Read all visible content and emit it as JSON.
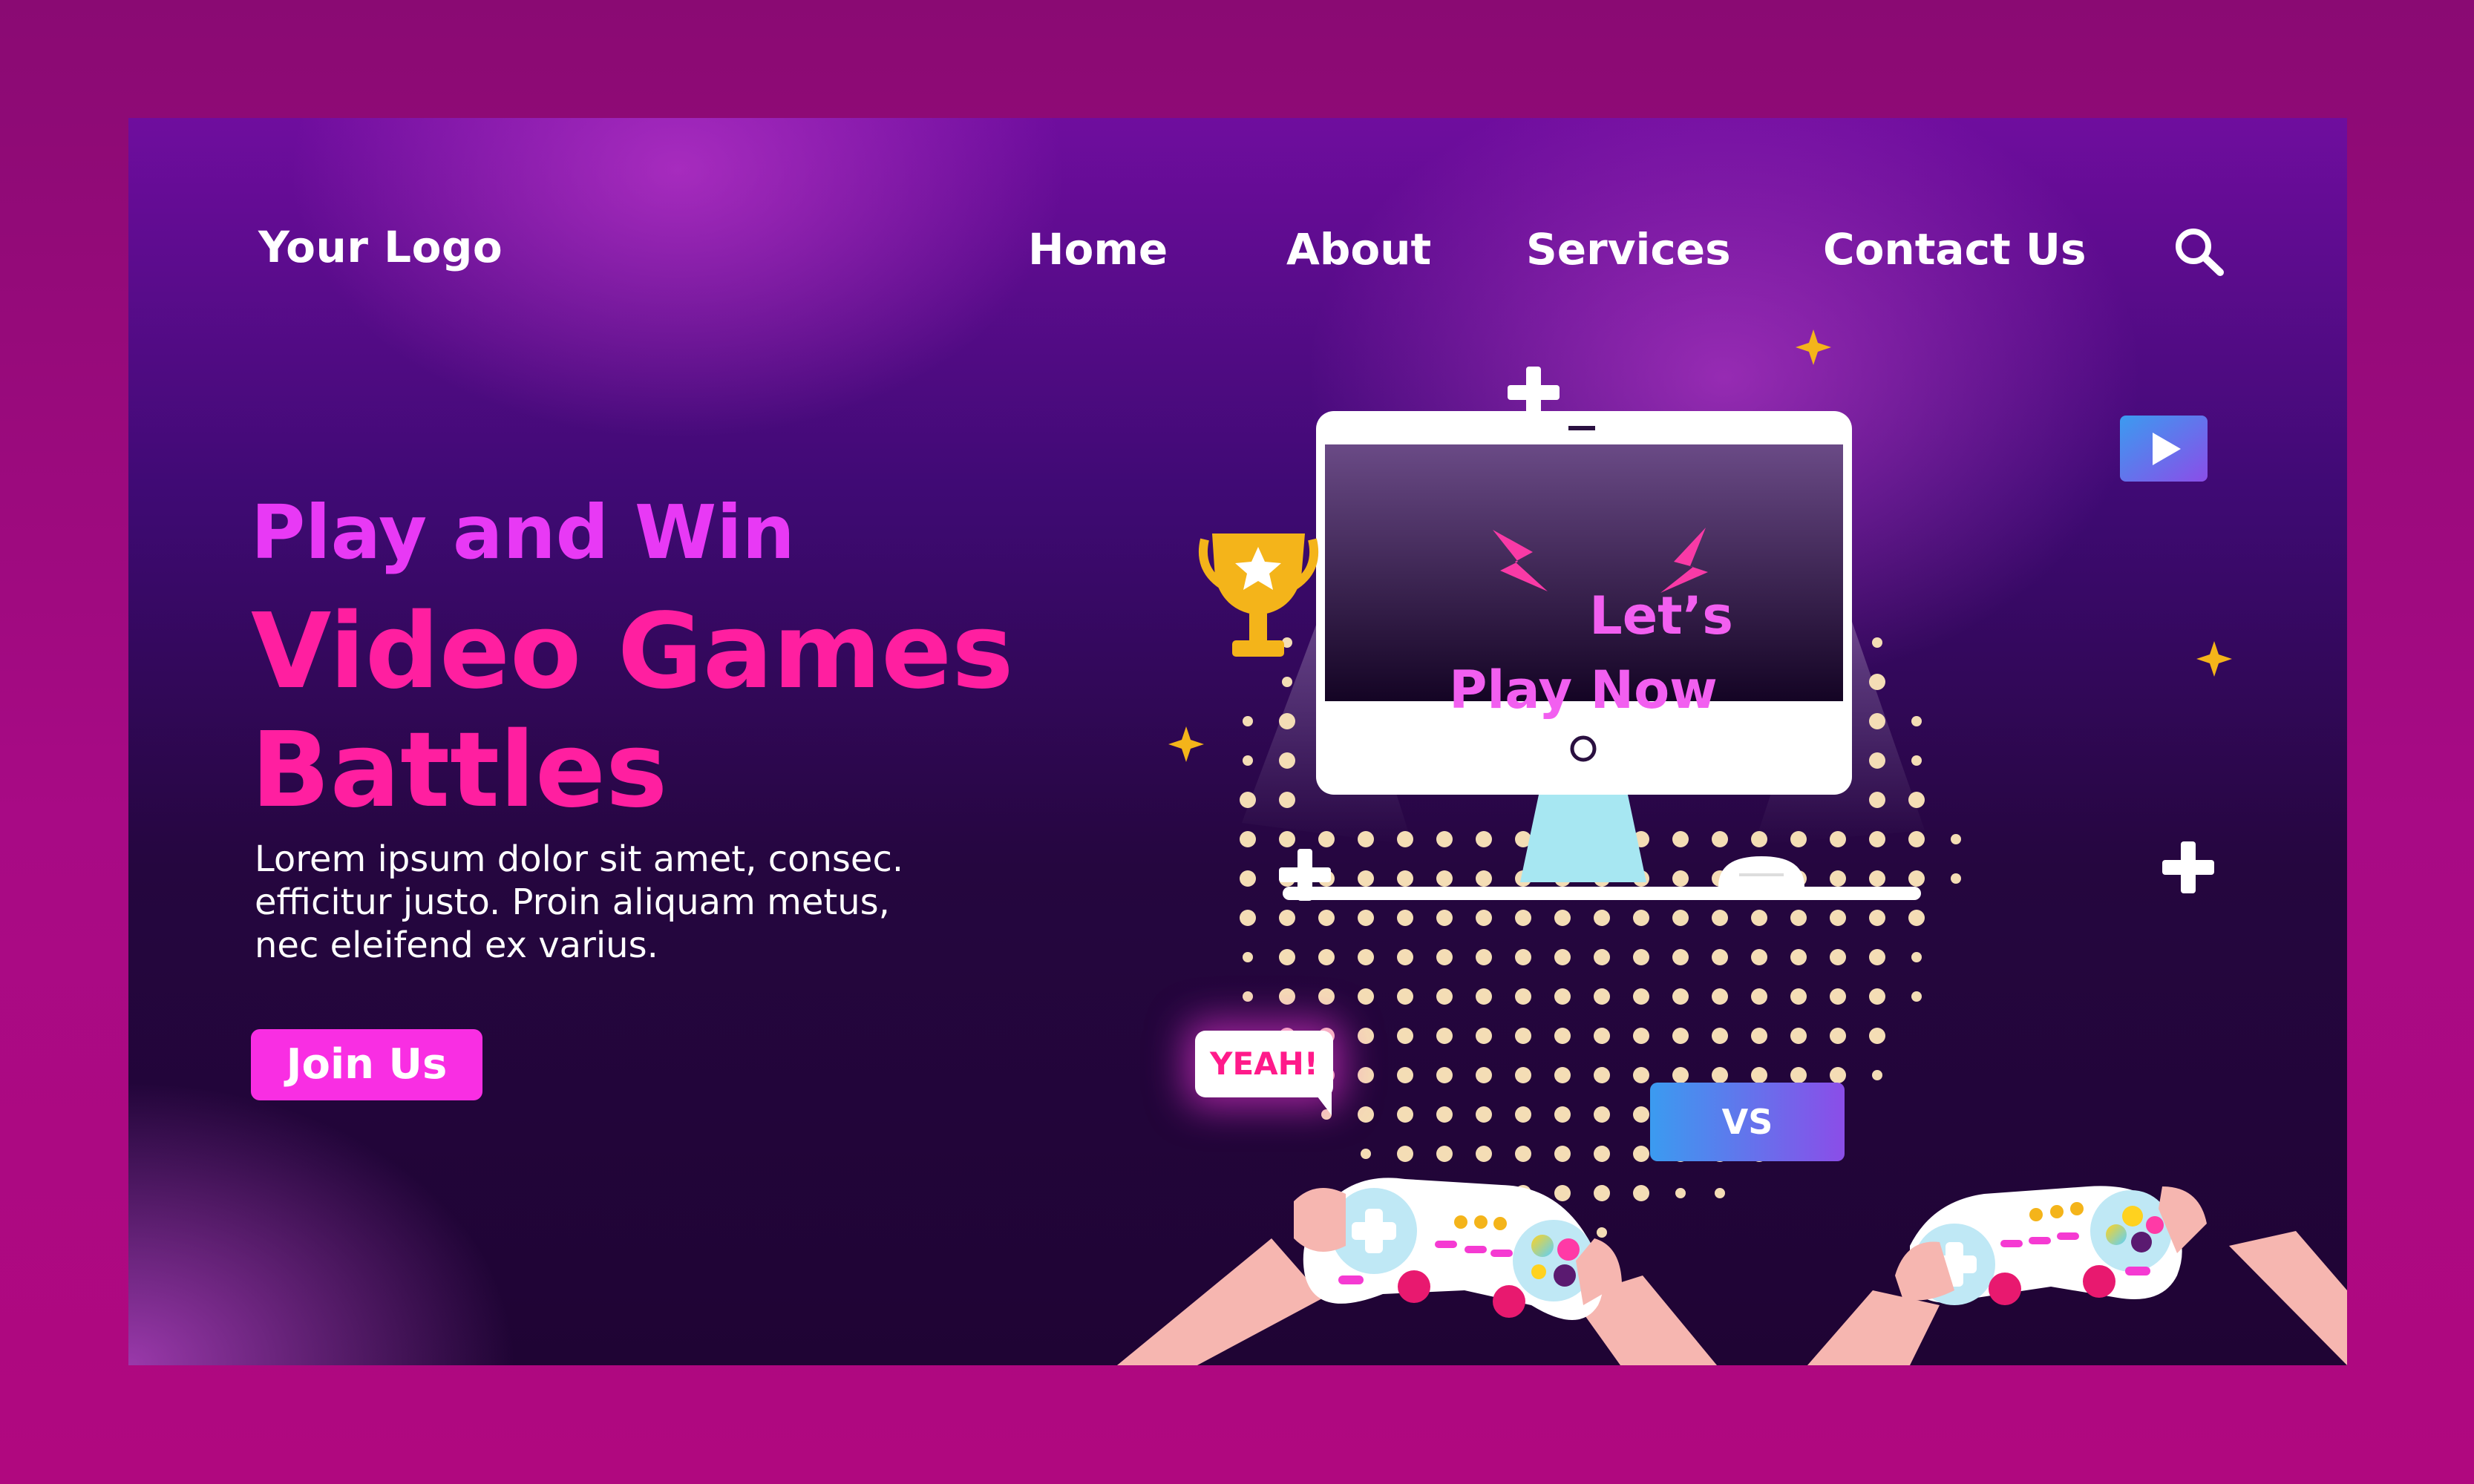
{
  "header": {
    "logo": "Your Logo",
    "nav": [
      "Home",
      "About",
      "Services",
      "Contact Us"
    ],
    "search_icon": "search-icon"
  },
  "hero": {
    "subtitle": "Play and Win",
    "headline_line1": "Video Games",
    "headline_line2": "Battles",
    "description_line1": "Lorem ipsum dolor sit amet, consec.",
    "description_line2": "efficitur justo. Proin aliquam metus,",
    "description_line3": "nec eleifend ex varius.",
    "cta": "Join Us"
  },
  "illustration": {
    "screen_line1": "Let’s",
    "screen_line2": "Play Now",
    "speech_bubble": "YEAH!",
    "versus": "VS",
    "icons": [
      "trophy-icon",
      "play-icon",
      "plus-icon",
      "sparkle-icon",
      "lightning-icon",
      "user-icon",
      "gamepad-icon",
      "mouse-icon"
    ]
  },
  "colors": {
    "accent_pink": "#ff1fa0",
    "accent_magenta": "#e839f5",
    "button": "#f92ee3",
    "frame": "#a80a85",
    "background_dark": "#25063f"
  }
}
